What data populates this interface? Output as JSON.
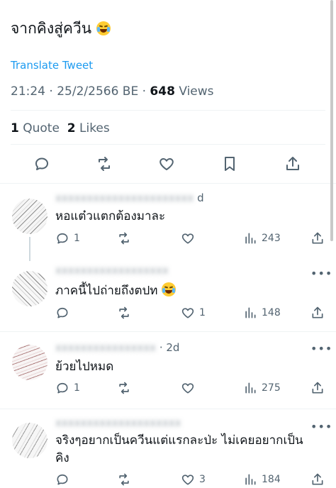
{
  "tweet": {
    "text": "จากคิงสู่ควีน",
    "translate_link": "Translate Tweet",
    "time": "21:24",
    "date": "25/2/2566 BE",
    "views_count": "648",
    "views_label": "Views",
    "quote_count": "1",
    "quote_label": "Quote",
    "likes_count": "2",
    "likes_label": "Likes"
  },
  "actions": [
    "reply-icon",
    "retweet-icon",
    "like-icon",
    "bookmark-icon",
    "share-icon"
  ],
  "replies": [
    {
      "username_blurred": "xxxxxxxxxxxxxxxxxxxxxx",
      "time": "d",
      "more": "•••",
      "text": "หอแต๋วแตกต้องมาละ",
      "reply_count": "1",
      "retweet_count": "",
      "like_count": "",
      "views": "243"
    },
    {
      "username_blurred": "xxxxxxxxxxxxxxxxxx",
      "time": "",
      "more": "•••",
      "text": "ภาคนี้ไปถ่ายถึงตปท",
      "reply_count": "",
      "retweet_count": "",
      "like_count": "1",
      "views": "148"
    },
    {
      "username_blurred": "xxxxxxxxxxxxxxxx",
      "time": "· 2d",
      "more": "•••",
      "text": "ย้วยไปหมด",
      "reply_count": "1",
      "retweet_count": "",
      "like_count": "",
      "views": "275"
    },
    {
      "username_blurred": "xxxxxxxxxxxxxxxxxxxx",
      "time": "",
      "more": "•••",
      "text": "จริงๆอยากเป็นควีนแต่แรกละป่ะ ไม่เคยอยากเป็น",
      "text2": "คิง",
      "reply_count": "",
      "retweet_count": "",
      "like_count": "3",
      "views": "184"
    }
  ],
  "colors": {
    "link": "#1d9bf0",
    "secondary": "#536471",
    "primary": "#0f1419",
    "divider": "#eff3f4"
  }
}
